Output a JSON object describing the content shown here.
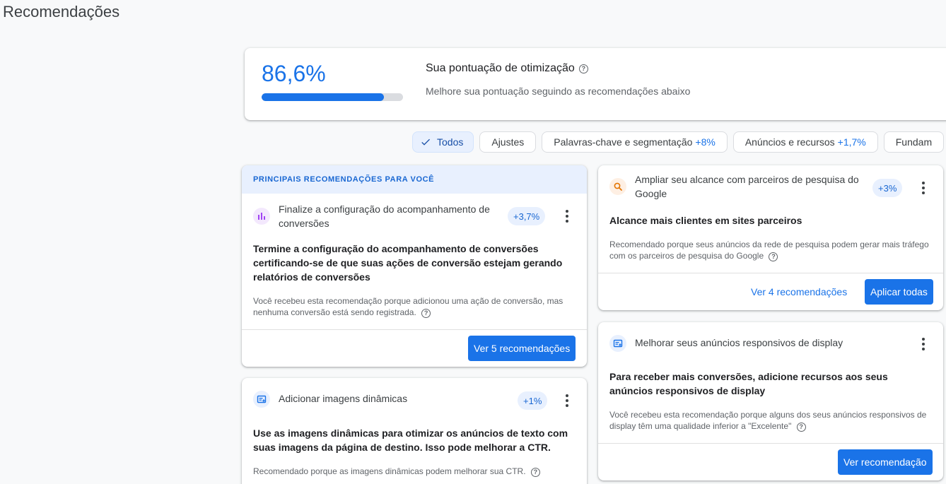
{
  "page": {
    "title": "Recomendações"
  },
  "score": {
    "value": "86,6%",
    "progress": 0.866,
    "title": "Sua pontuação de otimização",
    "subtitle": "Melhore sua pontuação seguindo as recomendações abaixo"
  },
  "filters": [
    {
      "label": "Todos",
      "delta": "",
      "selected": true
    },
    {
      "label": "Ajustes",
      "delta": ""
    },
    {
      "label": "Palavras-chave e segmentação",
      "delta": "+8%"
    },
    {
      "label": "Anúncios e recursos",
      "delta": "+1,7%"
    },
    {
      "label": "Fundam",
      "delta": ""
    }
  ],
  "top_section_label": "PRINCIPAIS RECOMENDAÇÕES PARA VOCÊ",
  "cards": {
    "conversions": {
      "title": "Finalize a configuração do acompanhamento de conversões",
      "badge": "+3,7%",
      "body_title": "Termine a configuração do acompanhamento de conversões certificando-se de que suas ações de conversão estejam gerando relatórios de conversões",
      "desc": "Você recebeu esta recomendação porque adicionou uma ação de conversão, mas nenhuma conversão está sendo registrada.",
      "primary_button": "Ver 5 recomendações"
    },
    "dynamic_images": {
      "title": "Adicionar imagens dinâmicas",
      "badge": "+1%",
      "body_title": "Use as imagens dinâmicas para otimizar os anúncios de texto com suas imagens da página de destino. Isso pode melhorar a CTR.",
      "desc": "Recomendado porque as imagens dinâmicas podem melhorar sua CTR."
    },
    "search_partners": {
      "title": "Ampliar seu alcance com parceiros de pesquisa do Google",
      "badge": "+3%",
      "body_title": "Alcance mais clientes em sites parceiros",
      "desc": "Recomendado porque seus anúncios da rede de pesquisa podem gerar mais tráfego com os parceiros de pesquisa do Google",
      "text_button": "Ver 4 recomendações",
      "primary_button": "Aplicar todas"
    },
    "display_ads": {
      "title": "Melhorar seus anúncios responsivos de display",
      "body_title": "Para receber mais conversões, adicione recursos aos seus anúncios responsivos de display",
      "desc": "Você recebeu esta recomendação porque alguns dos seus anúncios responsivos de display têm uma qualidade inferior a \"Excelente\"",
      "primary_button": "Ver recomendação"
    }
  },
  "colors": {
    "accent": "#1a73e8",
    "badge_bg": "#e8f0fe",
    "conversion_icon": "#a142f4",
    "search_icon": "#e37400"
  }
}
